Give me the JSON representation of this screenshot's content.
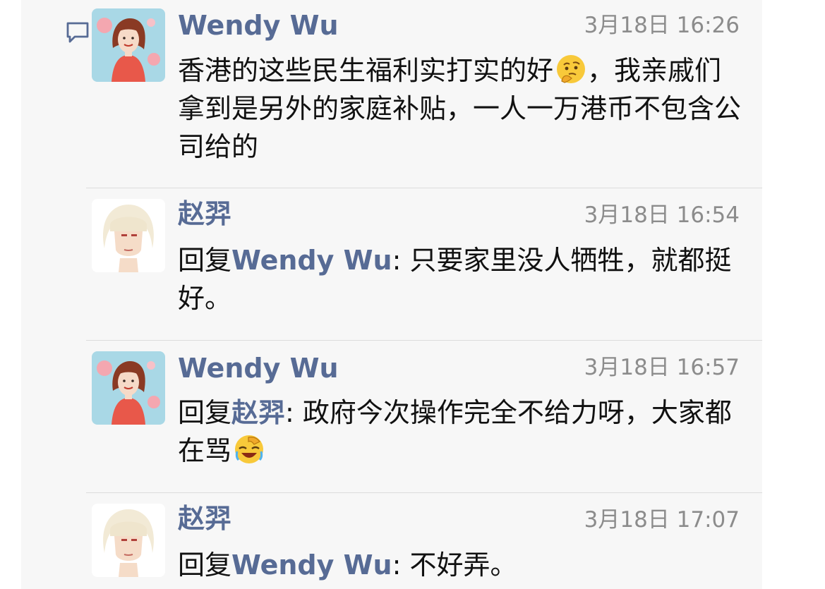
{
  "icons": {
    "comment": "comment-bubble-icon"
  },
  "colors": {
    "panel_bg": "#f7f7f7",
    "name": "#576b95",
    "text": "#111111",
    "time": "#8c8c8c",
    "divider": "#dcdcdc"
  },
  "comments": [
    {
      "author": "Wendy Wu",
      "time": "3月18日 16:26",
      "reply_prefix": "",
      "reply_to": "",
      "reply_sep": "",
      "text": "香港的这些民生福利实打实的好",
      "emoji": "thinking-face-icon",
      "text_after": "，我亲戚们拿到是另外的家庭补贴，一人一万港币不包含公司给的"
    },
    {
      "author": "赵羿",
      "time": "3月18日 16:54",
      "reply_prefix": "回复",
      "reply_to": "Wendy Wu",
      "reply_sep": ": ",
      "text": "只要家里没人牺牲，就都挺好。"
    },
    {
      "author": "Wendy Wu",
      "time": "3月18日 16:57",
      "reply_prefix": "回复",
      "reply_to": "赵羿",
      "reply_sep": ": ",
      "text": "政府今次操作完全不给力呀，大家都在骂",
      "emoji": "facepalm-laugh-icon"
    },
    {
      "author": "赵羿",
      "time": "3月18日 17:07",
      "reply_prefix": "回复",
      "reply_to": "Wendy Wu",
      "reply_sep": ": ",
      "text": "不好弄。"
    }
  ]
}
